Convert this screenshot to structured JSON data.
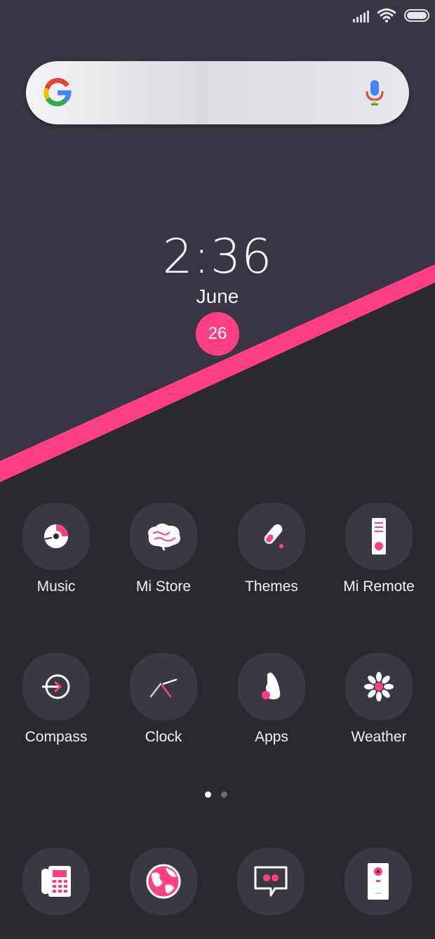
{
  "colors": {
    "accent": "#ff3f84",
    "background_top": "#373642",
    "background_bottom": "#2a2930",
    "tile": "#3a3942"
  },
  "status_bar": {
    "icons": [
      "signal-icon",
      "wifi-icon",
      "battery-icon"
    ]
  },
  "search": {
    "logo": "google-g-icon",
    "voice": "microphone-icon"
  },
  "clock": {
    "time": "2:36",
    "month": "June",
    "day": "26"
  },
  "apps": [
    {
      "label": "Music",
      "icon": "music-disc-icon"
    },
    {
      "label": "Mi Store",
      "icon": "brain-icon"
    },
    {
      "label": "Themes",
      "icon": "test-tube-icon"
    },
    {
      "label": "Mi Remote",
      "icon": "remote-icon"
    },
    {
      "label": "Compass",
      "icon": "arrow-in-circle-icon"
    },
    {
      "label": "Clock",
      "icon": "clock-hands-icon"
    },
    {
      "label": "Apps",
      "icon": "bear-icon"
    },
    {
      "label": "Weather",
      "icon": "sun-flower-icon"
    }
  ],
  "page_indicator": {
    "pages": 2,
    "current": 1
  },
  "dock": [
    {
      "icon": "phone-icon"
    },
    {
      "icon": "globe-icon"
    },
    {
      "icon": "message-icon"
    },
    {
      "icon": "camera-icon"
    }
  ]
}
